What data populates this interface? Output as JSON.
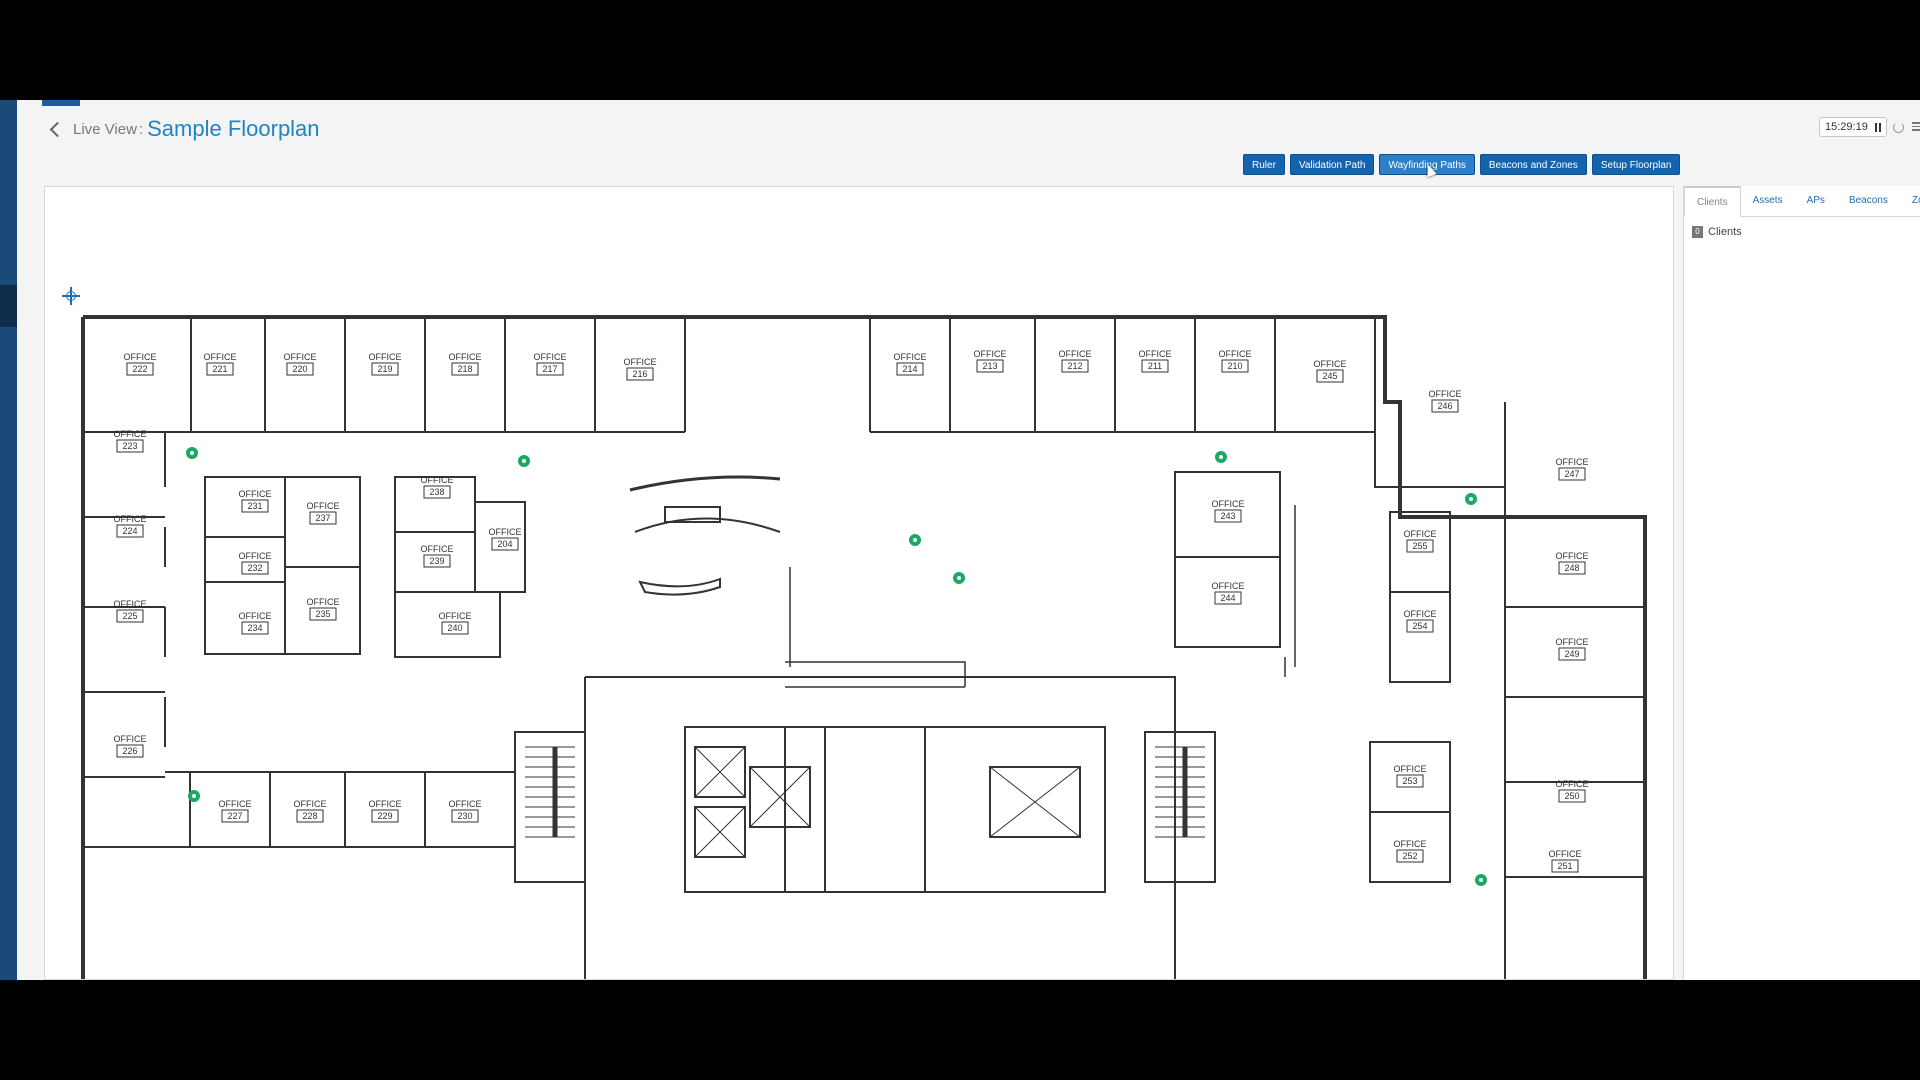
{
  "breadcrumb": {
    "parent": "Live View",
    "separator": ":",
    "title": "Sample Floorplan"
  },
  "clock": {
    "time": "15:29:19"
  },
  "toolbar": {
    "ruler": "Ruler",
    "validation_path": "Validation Path",
    "wayfinding_paths": "Wayfinding Paths",
    "beacons_and_zones": "Beacons and Zones",
    "setup_floorplan": "Setup Floorplan"
  },
  "side_panel": {
    "tabs": [
      "Clients",
      "Assets",
      "APs",
      "Beacons",
      "Zone"
    ],
    "active_tab": "Clients",
    "clients_count": "0",
    "clients_label": "Clients"
  },
  "floorplan": {
    "room_label": "OFFICE",
    "rooms": [
      "222",
      "221",
      "220",
      "219",
      "218",
      "217",
      "216",
      "214",
      "213",
      "212",
      "211",
      "210",
      "245",
      "246",
      "223",
      "231",
      "237",
      "238",
      "204",
      "239",
      "240",
      "224",
      "232",
      "225",
      "234",
      "235",
      "243",
      "244",
      "247",
      "255",
      "248",
      "254",
      "249",
      "226",
      "227",
      "228",
      "229",
      "230",
      "253",
      "250",
      "252",
      "251"
    ],
    "access_point_count": 8,
    "colors": {
      "ap": "#1aa865",
      "wall": "#333333",
      "accent": "#1f84c4",
      "button": "#1464ad"
    }
  }
}
